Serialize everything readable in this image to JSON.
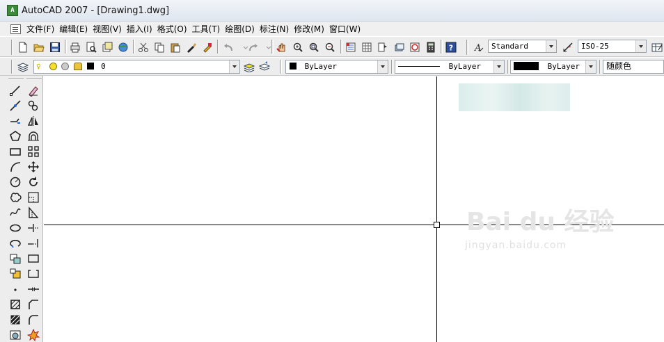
{
  "window": {
    "title": "AutoCAD 2007 - [Drawing1.dwg]",
    "app_icon_text": "A"
  },
  "menu": {
    "items": [
      "文件(F)",
      "编辑(E)",
      "视图(V)",
      "插入(I)",
      "格式(O)",
      "工具(T)",
      "绘图(D)",
      "标注(N)",
      "修改(M)",
      "窗口(W)"
    ]
  },
  "toolbar_standard": {
    "text_style": "Standard",
    "dim_style": "ISO-25"
  },
  "toolbar_layers": {
    "layer_name": "0",
    "color": "ByLayer",
    "linetype": "ByLayer",
    "lineweight": "ByLayer",
    "plot_style": "随颜色"
  },
  "watermark": {
    "logo": "Bai du 经验",
    "url": "jingyan.baidu.com"
  },
  "colors": {
    "accent_title": "#dfe6ef",
    "toolbar": "#ededed",
    "canvas": "#ffffff"
  }
}
